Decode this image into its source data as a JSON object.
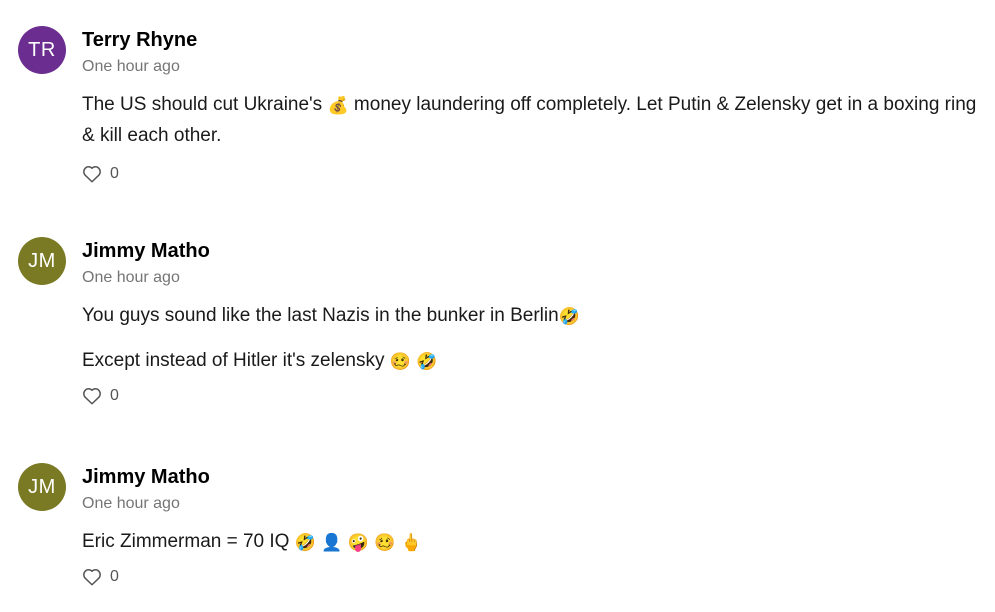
{
  "comments": [
    {
      "initials": "TR",
      "avatar_color": "#6b2d8f",
      "author": "Terry Rhyne",
      "time": "One hour ago",
      "paragraphs": [
        {
          "parts": [
            {
              "t": "text",
              "v": "The US should cut Ukraine's "
            },
            {
              "t": "emoji",
              "v": "💰",
              "icon": "money-bag-icon"
            },
            {
              "t": "text",
              "v": " money laundering off completely. Let Putin & Zelensky get in a boxing ring & kill each other."
            }
          ]
        }
      ],
      "likes": "0"
    },
    {
      "initials": "JM",
      "avatar_color": "#7b7a24",
      "author": "Jimmy Matho",
      "time": "One hour ago",
      "paragraphs": [
        {
          "parts": [
            {
              "t": "text",
              "v": "You guys sound like the last Nazis in the bunker in Berlin"
            },
            {
              "t": "emoji",
              "v": "🤣",
              "icon": "rolling-laughing-icon"
            }
          ]
        },
        {
          "parts": [
            {
              "t": "text",
              "v": "Except instead of Hitler it's zelensky "
            },
            {
              "t": "emoji",
              "v": "🥴",
              "icon": "woozy-face-icon"
            },
            {
              "t": "text",
              "v": " "
            },
            {
              "t": "emoji",
              "v": "🤣",
              "icon": "rolling-laughing-icon"
            }
          ]
        }
      ],
      "likes": "0"
    },
    {
      "initials": "JM",
      "avatar_color": "#7b7a24",
      "author": "Jimmy Matho",
      "time": "One hour ago",
      "paragraphs": [
        {
          "parts": [
            {
              "t": "text",
              "v": "Eric Zimmerman = 70 IQ "
            },
            {
              "t": "emoji",
              "v": "🤣",
              "icon": "rolling-laughing-icon"
            },
            {
              "t": "text",
              "v": " "
            },
            {
              "t": "emoji",
              "v": "👤",
              "icon": "person-silhouette-icon"
            },
            {
              "t": "text",
              "v": " "
            },
            {
              "t": "emoji",
              "v": "🤪",
              "icon": "zany-face-icon"
            },
            {
              "t": "text",
              "v": " "
            },
            {
              "t": "emoji",
              "v": "🥴",
              "icon": "woozy-face-icon"
            },
            {
              "t": "text",
              "v": " "
            },
            {
              "t": "emoji",
              "v": "🖕",
              "icon": "middle-finger-icon"
            }
          ]
        }
      ],
      "likes": "0"
    }
  ]
}
